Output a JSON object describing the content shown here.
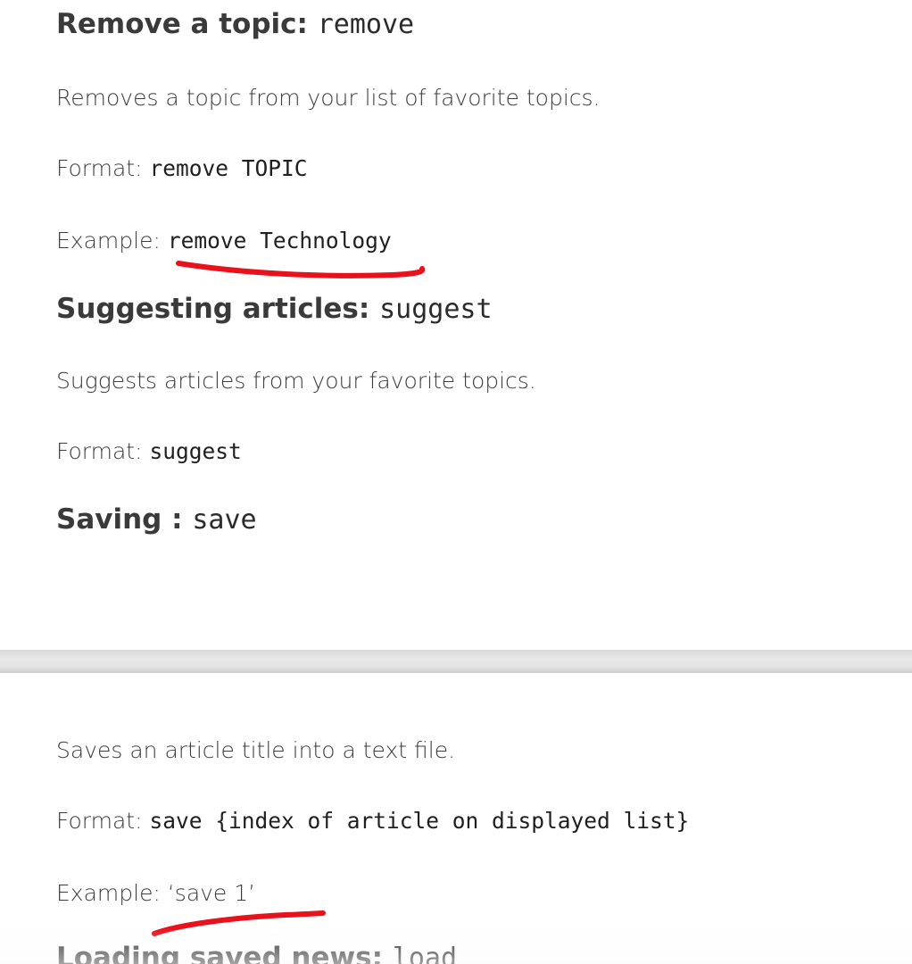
{
  "sections": {
    "remove": {
      "heading": "Remove a topic:",
      "command": "remove",
      "description": "Removes a topic from your list of favorite topics.",
      "format_label": "Format:",
      "format_value": "remove TOPIC",
      "example_label": "Example:",
      "example_value": "remove Technology"
    },
    "suggest": {
      "heading": "Suggesting articles:",
      "command": "suggest",
      "description": "Suggests articles from your favorite topics.",
      "format_label": "Format:",
      "format_value": "suggest"
    },
    "save": {
      "heading": "Saving :",
      "command": "save",
      "description": "Saves an article title into a text file.",
      "format_label": "Format:",
      "format_value": "save {index of article on displayed list}",
      "example_label": "Example:",
      "example_value": "‘save 1’"
    },
    "load": {
      "heading": "Loading saved news:",
      "command": "load"
    }
  },
  "annotation_color": "#e8121c"
}
